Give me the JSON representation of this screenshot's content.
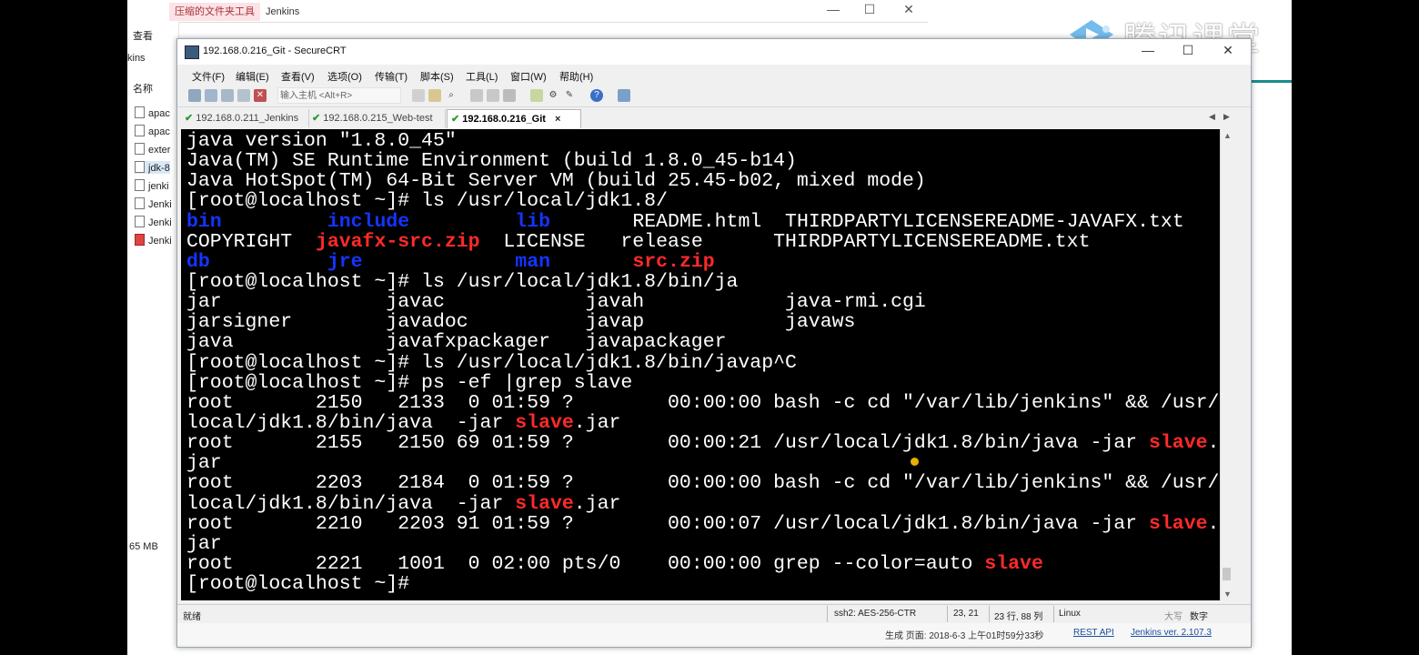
{
  "background_window": {
    "tabs": [
      "压缩的文件夹工具",
      "Jenkins"
    ],
    "ribbon_label": "查看",
    "address_partial": "kins",
    "column_name": "名称",
    "files": [
      "apac",
      "apac",
      "exter",
      "jdk-8",
      "jenki",
      "Jenki",
      "Jenki",
      "Jenki"
    ],
    "size_status": "65 MB",
    "controls": [
      "—",
      "☐",
      "✕"
    ]
  },
  "watermark": {
    "text": "腾讯课堂"
  },
  "crt_window": {
    "title": "192.168.0.216_Git - SecureCRT",
    "controls": [
      "—",
      "☐",
      "✕"
    ],
    "menu": [
      "文件(F)",
      "编辑(E)",
      "查看(V)",
      "选项(O)",
      "传输(T)",
      "脚本(S)",
      "工具(L)",
      "窗口(W)",
      "帮助(H)"
    ],
    "host_placeholder": "输入主机 <Alt+R>",
    "tabs": [
      {
        "label": "192.168.0.211_Jenkins",
        "active": false
      },
      {
        "label": "192.168.0.215_Web-test",
        "active": false
      },
      {
        "label": "192.168.0.216_Git",
        "active": true
      }
    ],
    "tab_close": "×",
    "terminal_lines": [
      [
        {
          "t": "java version \"1.8.0_45\""
        }
      ],
      [
        {
          "t": "Java(TM) SE Runtime Environment (build 1.8.0_45-b14)"
        }
      ],
      [
        {
          "t": "Java HotSpot(TM) 64-Bit Server VM (build 25.45-b02, mixed mode)"
        }
      ],
      [
        {
          "t": "[root@localhost ~]# ls /usr/local/jdk1.8/"
        }
      ],
      [
        {
          "t": "bin",
          "c": "blue"
        },
        {
          "t": "         "
        },
        {
          "t": "include",
          "c": "blue"
        },
        {
          "t": "         "
        },
        {
          "t": "lib",
          "c": "blue"
        },
        {
          "t": "       README.html  THIRDPARTYLICENSEREADME-JAVAFX.txt"
        }
      ],
      [
        {
          "t": "COPYRIGHT  "
        },
        {
          "t": "javafx-src.zip",
          "c": "red"
        },
        {
          "t": "  LICENSE   release      THIRDPARTYLICENSEREADME.txt"
        }
      ],
      [
        {
          "t": "db",
          "c": "blue"
        },
        {
          "t": "          "
        },
        {
          "t": "jre",
          "c": "blue"
        },
        {
          "t": "             "
        },
        {
          "t": "man",
          "c": "blue"
        },
        {
          "t": "       "
        },
        {
          "t": "src.zip",
          "c": "red"
        }
      ],
      [
        {
          "t": "[root@localhost ~]# ls /usr/local/jdk1.8/bin/ja"
        }
      ],
      [
        {
          "t": "jar              javac            javah            java-rmi.cgi"
        }
      ],
      [
        {
          "t": "jarsigner        javadoc          javap            javaws"
        }
      ],
      [
        {
          "t": "java             javafxpackager   javapackager"
        }
      ],
      [
        {
          "t": "[root@localhost ~]# ls /usr/local/jdk1.8/bin/javap^C"
        }
      ],
      [
        {
          "t": "[root@localhost ~]# ps -ef |grep slave"
        }
      ],
      [
        {
          "t": "root       2150   2133  0 01:59 ?        00:00:00 bash -c cd \"/var/lib/jenkins\" && /usr/"
        }
      ],
      [
        {
          "t": "local/jdk1.8/bin/java  -jar "
        },
        {
          "t": "slave",
          "c": "red"
        },
        {
          "t": ".jar"
        }
      ],
      [
        {
          "t": "root       2155   2150 69 01:59 ?        00:00:21 /usr/local/jdk1.8/bin/java -jar "
        },
        {
          "t": "slave",
          "c": "red"
        },
        {
          "t": "."
        }
      ],
      [
        {
          "t": "jar"
        }
      ],
      [
        {
          "t": "root       2203   2184  0 01:59 ?        00:00:00 bash -c cd \"/var/lib/jenkins\" && /usr/"
        }
      ],
      [
        {
          "t": "local/jdk1.8/bin/java  -jar "
        },
        {
          "t": "slave",
          "c": "red"
        },
        {
          "t": ".jar"
        }
      ],
      [
        {
          "t": "root       2210   2203 91 01:59 ?        00:00:07 /usr/local/jdk1.8/bin/java -jar "
        },
        {
          "t": "slave",
          "c": "red"
        },
        {
          "t": "."
        }
      ],
      [
        {
          "t": "jar"
        }
      ],
      [
        {
          "t": "root       2221   1001  0 02:00 pts/0    00:00:00 grep --color=auto "
        },
        {
          "t": "slave",
          "c": "red"
        }
      ],
      [
        {
          "t": "[root@localhost ~]#"
        }
      ]
    ],
    "status": {
      "ready": "就绪",
      "cipher": "ssh2: AES-256-CTR",
      "cursor_pos": "23,  21",
      "rows_cols": "23 行, 88 列",
      "os": "Linux",
      "caps": "大写",
      "num": "数字"
    },
    "footer": {
      "generated": "生成 页面: 2018-6-3 上午01时59分33秒",
      "rest_api": "REST API",
      "version": "Jenkins ver. 2.107.3"
    }
  }
}
